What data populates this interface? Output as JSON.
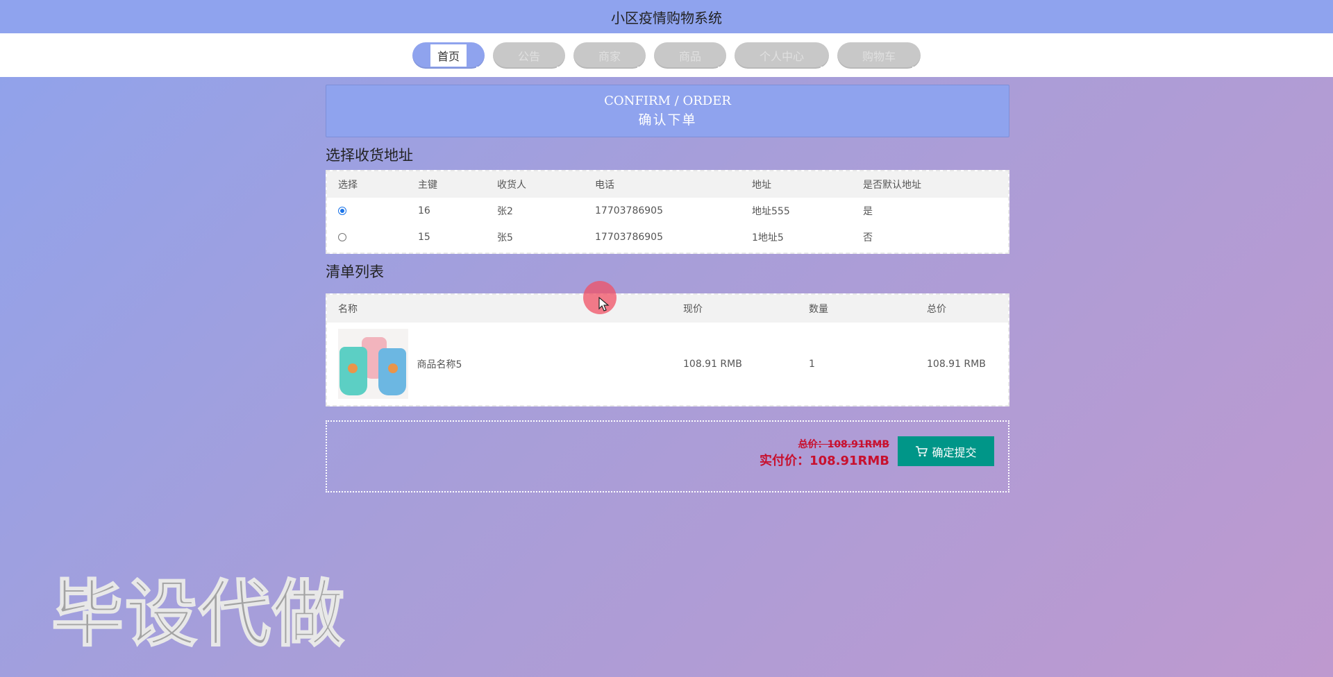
{
  "app": {
    "title": "小区疫情购物系统"
  },
  "nav": {
    "items": [
      {
        "label": "首页",
        "active": true
      },
      {
        "label": "公告",
        "active": false
      },
      {
        "label": "商家",
        "active": false
      },
      {
        "label": "商品",
        "active": false
      },
      {
        "label": "个人中心",
        "active": false
      },
      {
        "label": "购物车",
        "active": false
      }
    ]
  },
  "header": {
    "title_en": "CONFIRM / ORDER",
    "title_cn": "确认下单"
  },
  "address_section": {
    "title": "选择收货地址",
    "columns": [
      "选择",
      "主键",
      "收货人",
      "电话",
      "地址",
      "是否默认地址"
    ],
    "rows": [
      {
        "selected": true,
        "id": "16",
        "name": "张2",
        "phone": "17703786905",
        "address": "地址555",
        "default": "是"
      },
      {
        "selected": false,
        "id": "15",
        "name": "张5",
        "phone": "17703786905",
        "address": "1地址5",
        "default": "否"
      }
    ]
  },
  "items_section": {
    "title": "清单列表",
    "columns": [
      "名称",
      "现价",
      "数量",
      "总价"
    ],
    "rows": [
      {
        "name": "商品名称5",
        "price": "108.91 RMB",
        "qty": "1",
        "total": "108.91 RMB",
        "image": "plastic-cups-image"
      }
    ]
  },
  "summary": {
    "total_label": "总价：108.91RMB",
    "actual_label": "实付价：108.91RMB",
    "submit_label": "确定提交",
    "submit_icon": "cart-icon"
  },
  "watermark": "毕设代做",
  "colors": {
    "accent": "#8fa3ee",
    "submit": "#009688",
    "price": "#c8102e"
  }
}
